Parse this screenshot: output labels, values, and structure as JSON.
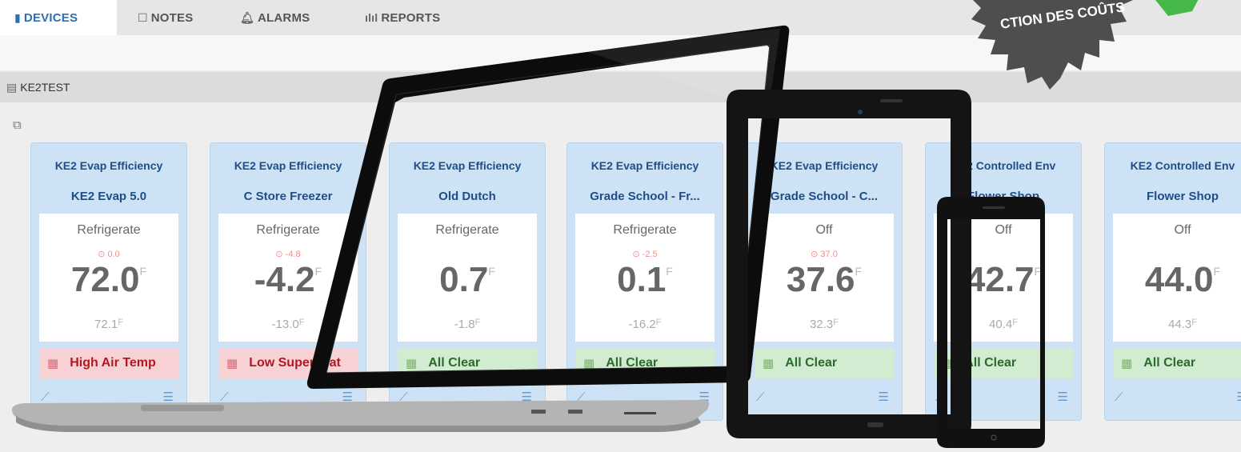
{
  "tabs": [
    {
      "label": "DEVICES",
      "icon": "tablet-icon",
      "active": true
    },
    {
      "label": "NOTES",
      "icon": "note-icon",
      "active": false
    },
    {
      "label": "ALARMS",
      "icon": "bell-icon",
      "active": false
    },
    {
      "label": "REPORTS",
      "icon": "bar-chart-icon",
      "active": false
    }
  ],
  "site": {
    "name": "KE2TEST"
  },
  "badge": {
    "text": "CTION DES COÛTS"
  },
  "unit": "F",
  "cards": [
    {
      "type": "KE2 Evap Efficiency",
      "name": "KE2 Evap 5.0",
      "mode": "Refrigerate",
      "setpoint": "0.0",
      "temp": "72.0",
      "secondary": "72.1",
      "status": "High Air Temp",
      "status_kind": "alarm"
    },
    {
      "type": "KE2 Evap Efficiency",
      "name": "C Store Freezer",
      "mode": "Refrigerate",
      "setpoint": "-4.8",
      "temp": "-4.2",
      "secondary": "-13.0",
      "status": "Low Superheat",
      "status_kind": "alarm"
    },
    {
      "type": "KE2 Evap Efficiency",
      "name": "Old Dutch",
      "mode": "Refrigerate",
      "setpoint": "",
      "temp": "0.7",
      "secondary": "-1.8",
      "status": "All Clear",
      "status_kind": "ok"
    },
    {
      "type": "KE2 Evap Efficiency",
      "name": "Grade School - Fr...",
      "mode": "Refrigerate",
      "setpoint": "-2.5",
      "temp": "0.1",
      "secondary": "-16.2",
      "status": "All Clear",
      "status_kind": "ok"
    },
    {
      "type": "KE2 Evap Efficiency",
      "name": "Grade School - C...",
      "mode": "Off",
      "setpoint": "37.0",
      "temp": "37.6",
      "secondary": "32.3",
      "status": "All Clear",
      "status_kind": "ok"
    },
    {
      "type": "KE2 Controlled Env",
      "name": "Flower Shop",
      "mode": "Off",
      "setpoint": "",
      "temp": "42.7",
      "secondary": "40.4",
      "status": "All Clear",
      "status_kind": "ok"
    },
    {
      "type": "KE2 Controlled Env",
      "name": "Flower Shop",
      "mode": "Off",
      "setpoint": "",
      "temp": "44.0",
      "secondary": "44.3",
      "status": "All Clear",
      "status_kind": "ok"
    }
  ]
}
